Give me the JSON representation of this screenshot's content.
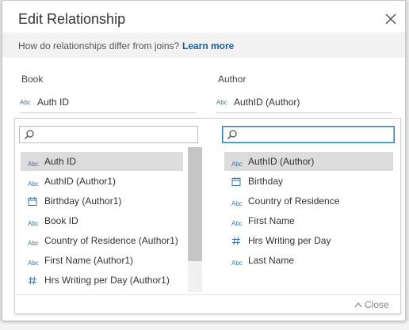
{
  "dialog": {
    "title": "Edit Relationship",
    "info_text": "How do relationships differ from joins?",
    "learn_more": "Learn more",
    "close_label": "Close"
  },
  "left": {
    "label": "Book",
    "selected_field": "Auth ID",
    "search_value": "",
    "items": [
      {
        "icon": "abc-icon",
        "label": "Auth ID",
        "selected": true
      },
      {
        "icon": "abc-icon",
        "label": "AuthID (Author1)"
      },
      {
        "icon": "calendar-icon",
        "label": "Birthday (Author1)"
      },
      {
        "icon": "abc-icon",
        "label": "Book ID"
      },
      {
        "icon": "abc-icon",
        "label": "Country of Residence (Author1)"
      },
      {
        "icon": "abc-icon",
        "label": "First Name (Author1)"
      },
      {
        "icon": "hash-icon",
        "label": "Hrs Writing per Day (Author1)"
      }
    ]
  },
  "right": {
    "label": "Author",
    "selected_field": "AuthID (Author)",
    "search_value": "",
    "items": [
      {
        "icon": "abc-icon",
        "label": "AuthID (Author)",
        "selected": true
      },
      {
        "icon": "calendar-icon",
        "label": "Birthday"
      },
      {
        "icon": "abc-icon",
        "label": "Country of Residence"
      },
      {
        "icon": "abc-icon",
        "label": "First Name"
      },
      {
        "icon": "hash-icon",
        "label": "Hrs Writing per Day"
      },
      {
        "icon": "abc-icon",
        "label": "Last Name"
      }
    ]
  },
  "icons": {
    "abc_text": "Abc"
  },
  "colors": {
    "accent": "#2d7dbf",
    "link": "#1a5c99",
    "selected_row": "#dcdcdc"
  }
}
